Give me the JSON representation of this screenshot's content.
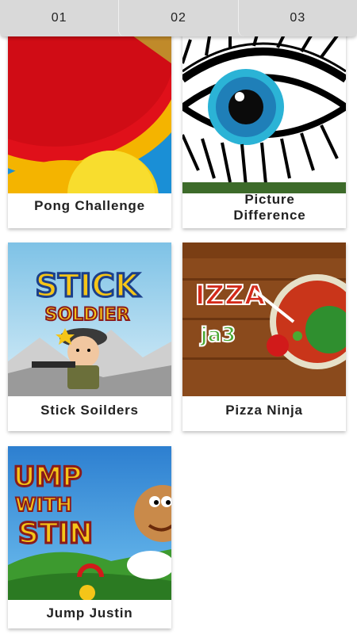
{
  "tabs": [
    {
      "label": "01"
    },
    {
      "label": "02"
    },
    {
      "label": "03"
    }
  ],
  "games": [
    {
      "title": "Pong  Challenge",
      "icon": "ping-pong-paddle-icon"
    },
    {
      "title": "Picture Difference",
      "icon": "eye-icon"
    },
    {
      "title": "Stick Soilders",
      "icon": "soldier-icon",
      "art_text": [
        "STICK",
        "SOLDIER"
      ]
    },
    {
      "title": "Pizza Ninja",
      "icon": "pizza-ninja-icon",
      "art_text": [
        "IZZA",
        "ja3"
      ]
    },
    {
      "title": "Jump Justin",
      "icon": "jump-justin-icon",
      "art_text": [
        "UMP",
        "WITH",
        "STIN"
      ]
    }
  ],
  "colors": {
    "tabbar": "#d9d9d9",
    "paddle_red": "#e0101a",
    "ball_yellow": "#f6d21a",
    "eye_blue": "#2bb3d6",
    "wood_brown": "#8a4a1c",
    "sky_blue": "#3aa0d8"
  }
}
